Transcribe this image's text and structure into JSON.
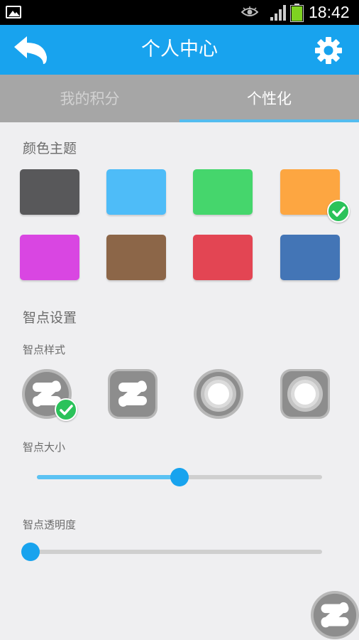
{
  "status_bar": {
    "time": "18:42",
    "icons": [
      "gallery-icon",
      "eye-icon",
      "signal-icon",
      "battery-icon"
    ]
  },
  "header": {
    "title": "个人中心",
    "back_icon": "back-arrow-icon",
    "settings_icon": "gear-icon",
    "background_color": "#18a3ee"
  },
  "tabs": [
    {
      "label": "我的积分",
      "selected": false
    },
    {
      "label": "个性化",
      "selected": true
    }
  ],
  "color_theme": {
    "title": "颜色主题",
    "swatches": [
      {
        "color": "#58585a",
        "selected": false
      },
      {
        "color": "#4ebcf8",
        "selected": false
      },
      {
        "color": "#45d66c",
        "selected": false
      },
      {
        "color": "#fda641",
        "selected": true
      },
      {
        "color": "#d946e2",
        "selected": false
      },
      {
        "color": "#8c6648",
        "selected": false
      },
      {
        "color": "#e34553",
        "selected": false
      },
      {
        "color": "#4375b6",
        "selected": false
      }
    ]
  },
  "smart_dot_settings": {
    "title": "智点设置",
    "style": {
      "label": "智点样式",
      "options": [
        {
          "icon": "z-round-icon",
          "selected": true
        },
        {
          "icon": "z-square-icon",
          "selected": false
        },
        {
          "icon": "ring-round-icon",
          "selected": false
        },
        {
          "icon": "ring-square-icon",
          "selected": false
        }
      ]
    },
    "size": {
      "label": "智点大小",
      "value_percent": 50
    },
    "opacity": {
      "label": "智点透明度",
      "value_percent": 0
    }
  },
  "floating_button": {
    "icon": "z-round-icon"
  }
}
